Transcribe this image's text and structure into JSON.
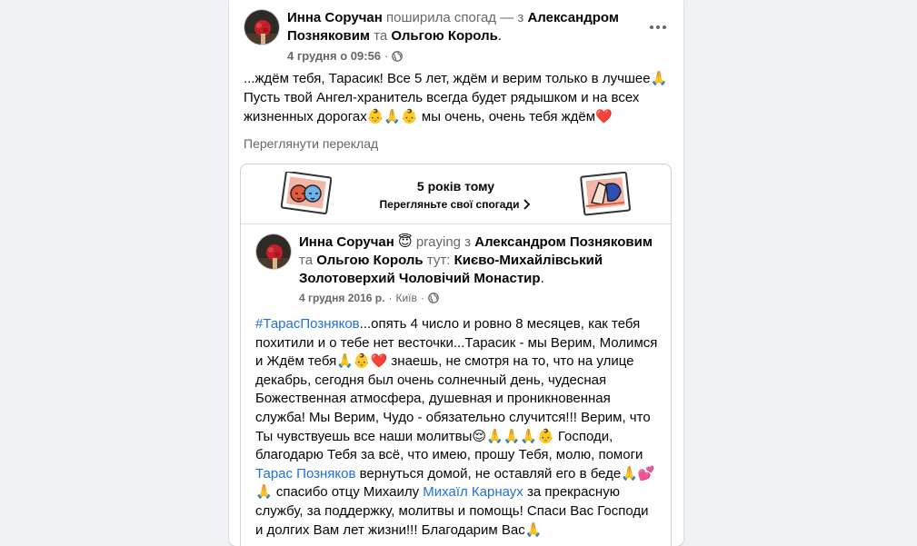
{
  "post": {
    "author": "Инна Соручан",
    "action": "поширила спогад — з",
    "with1": "Александром Позняковим",
    "and": "та",
    "with2": "Ольгою Король",
    "period": ".",
    "date": "4 грудня о 09:56",
    "dot": "·",
    "text_line1": "...ждём тебя, Тарасик! Все 5 лет, ждём и верим только в лучшее🙏",
    "text_line2": "Пусть твой Ангел-хранитель всегда будет рядышком и на всех",
    "text_line3": "жизненных дорогах👶🙏👶 мы очень, очень тебя ждём❤️",
    "see_translation": "Переглянути переклад"
  },
  "memory": {
    "title": "5 років тому",
    "subtitle": "Перегляньте свої спогади"
  },
  "inner": {
    "author": "Инна Соручан",
    "emoji": "😇",
    "activity": "praying з",
    "with1": "Александром Позняковим",
    "and": "та",
    "with2": "Ольгою Король",
    "at": "тут:",
    "place": "Києво-Михайлівський Золотоверхий Чоловічий Монастир",
    "period": ".",
    "date": "4 грудня 2016 р.",
    "dot1": "·",
    "city": "Київ",
    "dot2": "·",
    "hashtag": "#ТарасПозняков",
    "text_a": "...опять 4 число и ровно 8 месяцев, как тебя похитили и о тебе нет весточки...Тарасик - мы Верим, Молимся и Ждём тебя🙏👶❤️ знаешь, не смотря на то, что на улице декабрь, сегодня был очень солнечный день, чудесная Божественная атмосфера, душевная и  проникновенная служба! Мы Верим, Чудо - обязательно случится!!! Верим, что Ты чувствуешь все наши молитвы😌🙏🙏🙏👶 Господи, благодарю Тебя за всё, что имею, прошу Тебя, молю, помоги ",
    "mention1": "Тарас Позняков",
    "text_b": " вернуться домой, не оставляй его в беде🙏💕 🙏 спасибо отцу Михаилу ",
    "mention2": "Михаїл Карнаух",
    "text_c": " за прекрасную службу, за поддержку, молитвы и помощь! Спаси Вас Господи и долгих Вам лет жизни!!! Благодарим Вас🙏"
  },
  "icons": {
    "globe": "globe-icon",
    "more": "more-options-icon",
    "chevron": "chevron-right-icon"
  }
}
